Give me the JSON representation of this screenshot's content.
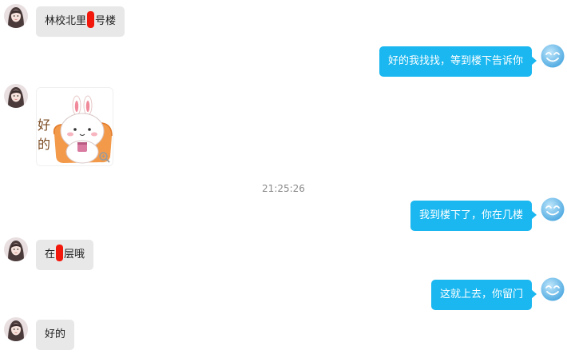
{
  "colors": {
    "incoming_bubble": "#e8e8e8",
    "outgoing_bubble": "#1ab7f0",
    "redaction": "#f2190c",
    "timestamp": "#8a8a8a"
  },
  "messages": [
    {
      "from": "contact",
      "parts": [
        "林校北里",
        "号楼"
      ],
      "redacted": true
    },
    {
      "from": "me",
      "text": "好的我找找，等到楼下告诉你"
    },
    {
      "from": "contact",
      "sticker": true,
      "sticker_text": [
        "好",
        "的"
      ]
    },
    {
      "timestamp": "21:25:26"
    },
    {
      "from": "me",
      "text": "我到楼下了，你在几楼"
    },
    {
      "from": "contact",
      "parts": [
        "在",
        "层哦"
      ],
      "redacted": true
    },
    {
      "from": "me",
      "text": "这就上去，你留门"
    },
    {
      "from": "contact",
      "text": "好的"
    }
  ],
  "icons": {
    "contact_avatar": "girl-avatar-icon",
    "self_avatar": "blue-smiley-avatar-icon",
    "zoom": "magnifier-icon"
  }
}
